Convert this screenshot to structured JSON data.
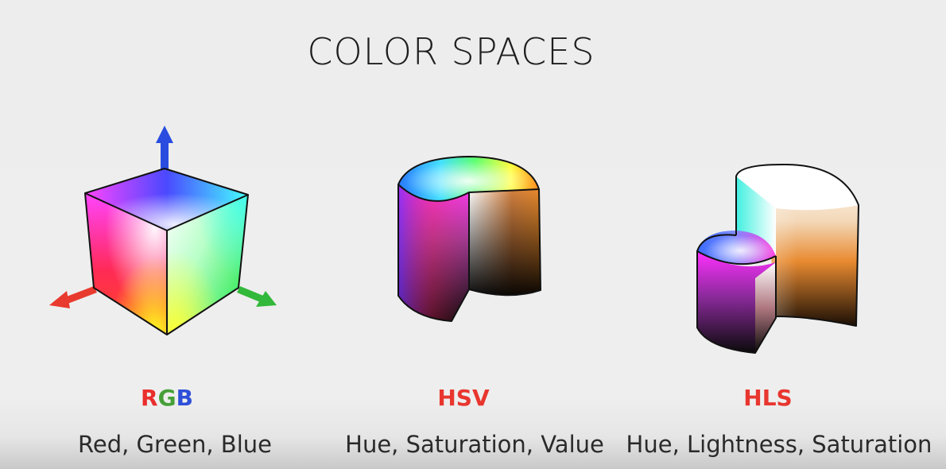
{
  "title": "COLOR SPACES",
  "spaces": [
    {
      "abbr": [
        "R",
        "G",
        "B"
      ],
      "description": "Red, Green, Blue"
    },
    {
      "abbr": "HSV",
      "description": "Hue, Saturation, Value"
    },
    {
      "abbr": "HLS",
      "description": "Hue, Lightness, Saturation"
    }
  ],
  "colors": {
    "red_label": "#e8362f",
    "green_label": "#46a038",
    "blue_label": "#2e4fd8",
    "axis_red": "#e83a2e",
    "axis_green": "#32b83a",
    "axis_blue": "#2a4de0"
  }
}
